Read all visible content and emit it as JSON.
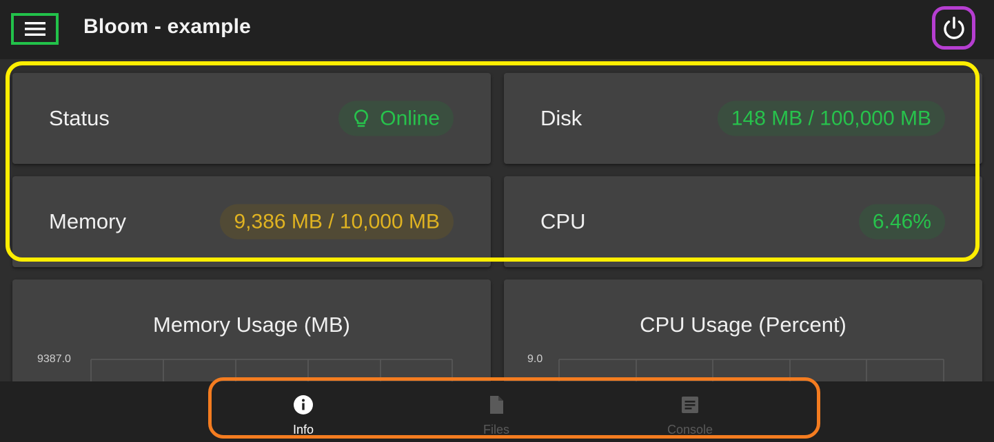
{
  "appbar": {
    "title": "Bloom - example",
    "menu_icon": "menu-icon",
    "power_icon": "power-icon"
  },
  "stats": {
    "status": {
      "label": "Status",
      "value": "Online",
      "icon": "lightbulb-icon",
      "color": "#27c24c"
    },
    "disk": {
      "label": "Disk",
      "value": "148 MB / 100,000 MB",
      "color": "#27c24c"
    },
    "memory": {
      "label": "Memory",
      "value": "9,386 MB / 10,000 MB",
      "color": "#e0b321"
    },
    "cpu": {
      "label": "CPU",
      "value": "6.46%",
      "color": "#27c24c"
    }
  },
  "charts": {
    "memory": {
      "title": "Memory Usage (MB)",
      "y_max_label": "9387.0"
    },
    "cpu": {
      "title": "CPU Usage (Percent)",
      "y_max_label": "9.0"
    }
  },
  "chart_data": [
    {
      "type": "line",
      "title": "Memory Usage (MB)",
      "ylim_top": 9387.0,
      "y_tick_labels": [
        "9387.0"
      ],
      "grid": true
    },
    {
      "type": "line",
      "title": "CPU Usage (Percent)",
      "ylim_top": 9.0,
      "y_tick_labels": [
        "9.0"
      ],
      "grid": true
    }
  ],
  "bottomnav": {
    "items": [
      {
        "label": "Info",
        "icon": "info-icon",
        "active": true
      },
      {
        "label": "Files",
        "icon": "file-icon",
        "active": false
      },
      {
        "label": "Console",
        "icon": "console-icon",
        "active": false
      }
    ]
  },
  "colors": {
    "accent_green": "#27c24c",
    "accent_amber": "#e0b321",
    "menu_highlight": "#22c24a",
    "power_highlight": "#b63ed1",
    "stats_highlight": "#ffee00",
    "nav_highlight": "#f47c20"
  }
}
